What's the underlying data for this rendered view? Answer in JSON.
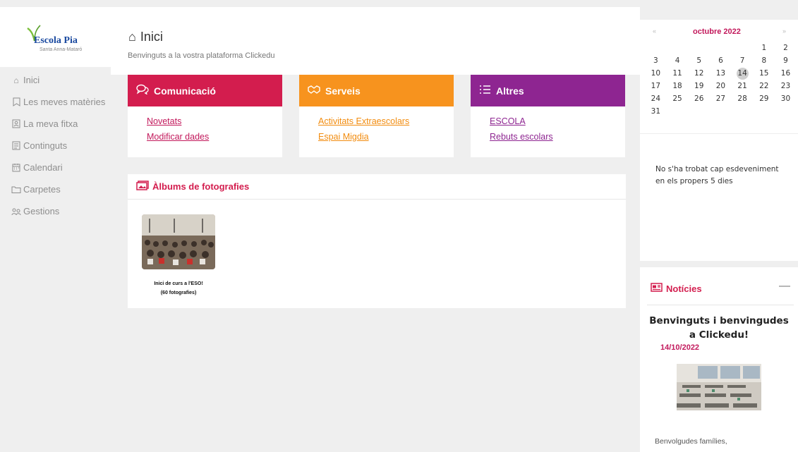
{
  "logo": {
    "name": "Escola Pia",
    "subtitle": "Santa Anna-Mataró"
  },
  "sidebar": {
    "items": [
      {
        "label": "Inici",
        "icon": "home-icon"
      },
      {
        "label": "Les meves matèries",
        "icon": "bookmark-icon"
      },
      {
        "label": "La meva fitxa",
        "icon": "profile-card-icon"
      },
      {
        "label": "Continguts",
        "icon": "content-icon"
      },
      {
        "label": "Calendari",
        "icon": "calendar-icon"
      },
      {
        "label": "Carpetes",
        "icon": "folder-icon"
      },
      {
        "label": "Gestions",
        "icon": "people-icon"
      }
    ]
  },
  "header": {
    "title": "Inici",
    "subtitle": "Benvinguts a la vostra plataforma Clickedu"
  },
  "cards": [
    {
      "title": "Comunicació",
      "icon": "chat-icon",
      "color": "#d31d4e",
      "link_color": "#c2185b",
      "links": [
        "Novetats",
        "Modificar dades"
      ]
    },
    {
      "title": "Serveis",
      "icon": "handshake-icon",
      "color": "#f7931e",
      "link_color": "#f28c0f",
      "links": [
        "Activitats Extraescolars",
        "Espai Migdia"
      ]
    },
    {
      "title": "Altres",
      "icon": "list-icon",
      "color": "#8e2591",
      "link_color": "#8e2591",
      "links": [
        "ESCOLA",
        "Rebuts escolars"
      ]
    }
  ],
  "albums": {
    "title": "Àlbums de fotografies",
    "items": [
      {
        "title": "Inici de curs a l'ESO!",
        "count": "(60 fotografies)"
      }
    ]
  },
  "calendar": {
    "month": "octubre 2022",
    "prev": "«",
    "next": "»",
    "today": "14",
    "weeks": [
      [
        "",
        "",
        "",
        "",
        "",
        "1",
        "2"
      ],
      [
        "3",
        "4",
        "5",
        "6",
        "7",
        "8",
        "9"
      ],
      [
        "10",
        "11",
        "12",
        "13",
        "14",
        "15",
        "16"
      ],
      [
        "17",
        "18",
        "19",
        "20",
        "21",
        "22",
        "23"
      ],
      [
        "24",
        "25",
        "26",
        "27",
        "28",
        "29",
        "30"
      ],
      [
        "31",
        "",
        "",
        "",
        "",
        "",
        ""
      ]
    ],
    "no_events": "No s'ha trobat cap esdeveniment en els propers 5 dies"
  },
  "news": {
    "title": "Notícies",
    "minimize": "—",
    "item_title": "Benvinguts i benvingudes a Clickedu!",
    "date": "14/10/2022",
    "body": "Benvolgudes famílies,"
  }
}
